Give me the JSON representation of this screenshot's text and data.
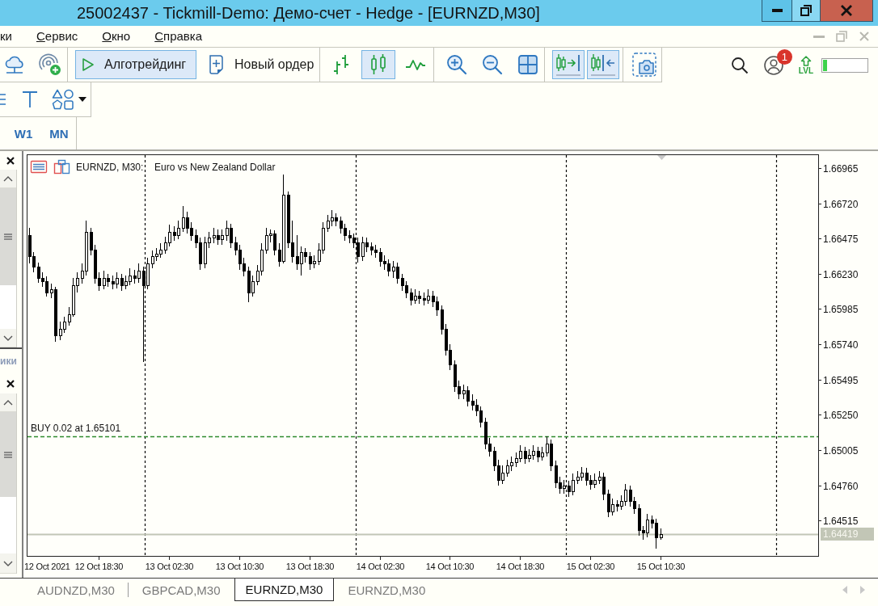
{
  "window": {
    "title": "25002437 - Tickmill-Demo: Демо-счет - Hedge - [EURNZD,M30]"
  },
  "menu": [
    {
      "label": "ки",
      "mnemonic": false
    },
    {
      "label": "Сервис",
      "mnemonic": true
    },
    {
      "label": "Окно",
      "mnemonic": true
    },
    {
      "label": "Справка",
      "mnemonic": true
    }
  ],
  "toolbar": {
    "groups": [
      [
        {
          "selected": false
        },
        {
          "selected": false
        }
      ],
      [
        {
          "label": "Алготрейдинг",
          "selected": true
        },
        {
          "label": "Новый ордер",
          "selected": false
        }
      ],
      [
        {
          "selected": false
        },
        {
          "selected": true
        },
        {
          "selected": false
        }
      ],
      [
        {
          "selected": false
        },
        {
          "selected": false
        },
        {
          "selected": false
        }
      ],
      [
        {
          "selected": true
        },
        {
          "selected": true
        }
      ],
      [
        {
          "selected": false
        }
      ]
    ],
    "account_badge": "1",
    "level_label": "LVL",
    "progress": {
      "level": 0.1
    }
  },
  "timeframes": [
    {
      "label": "W1",
      "selected": false
    },
    {
      "label": "MN",
      "selected": false
    }
  ],
  "dock": {
    "tab_label": "ики"
  },
  "chart": {
    "chart_data": {
      "type": "candlestick",
      "title": "EURNZD, M30:",
      "subtitle": "Euro vs New Zealand Dollar",
      "x": [
        "2021-10-12T10:30",
        "2021-10-12T11:00",
        "2021-10-12T11:30",
        "2021-10-12T12:00",
        "2021-10-12T12:30",
        "2021-10-12T13:00",
        "2021-10-12T13:30",
        "2021-10-12T14:00",
        "2021-10-12T14:30",
        "2021-10-12T15:00",
        "2021-10-12T15:30",
        "2021-10-12T16:00",
        "2021-10-12T16:30",
        "2021-10-12T17:00",
        "2021-10-12T17:30",
        "2021-10-12T18:00",
        "2021-10-12T18:30",
        "2021-10-12T19:00",
        "2021-10-12T19:30",
        "2021-10-12T20:00",
        "2021-10-12T20:30",
        "2021-10-12T21:00",
        "2021-10-12T21:30",
        "2021-10-12T22:00",
        "2021-10-12T22:30",
        "2021-10-12T23:00",
        "2021-10-12T23:30",
        "2021-10-13T00:00",
        "2021-10-13T00:30",
        "2021-10-13T01:00",
        "2021-10-13T01:30",
        "2021-10-13T02:00",
        "2021-10-13T02:30",
        "2021-10-13T03:00",
        "2021-10-13T03:30",
        "2021-10-13T04:00",
        "2021-10-13T04:30",
        "2021-10-13T05:00",
        "2021-10-13T05:30",
        "2021-10-13T06:00",
        "2021-10-13T06:30",
        "2021-10-13T07:00",
        "2021-10-13T07:30",
        "2021-10-13T08:00",
        "2021-10-13T08:30",
        "2021-10-13T09:00",
        "2021-10-13T09:30",
        "2021-10-13T10:00",
        "2021-10-13T10:30",
        "2021-10-13T11:00",
        "2021-10-13T11:30",
        "2021-10-13T12:00",
        "2021-10-13T12:30",
        "2021-10-13T13:00",
        "2021-10-13T13:30",
        "2021-10-13T14:00",
        "2021-10-13T14:30",
        "2021-10-13T15:00",
        "2021-10-13T15:30",
        "2021-10-13T16:00",
        "2021-10-13T16:30",
        "2021-10-13T17:00",
        "2021-10-13T17:30",
        "2021-10-13T18:00",
        "2021-10-13T18:30",
        "2021-10-13T19:00",
        "2021-10-13T19:30",
        "2021-10-13T20:00",
        "2021-10-13T20:30",
        "2021-10-13T21:00",
        "2021-10-13T21:30",
        "2021-10-13T22:00",
        "2021-10-13T22:30",
        "2021-10-13T23:00",
        "2021-10-13T23:30",
        "2021-10-14T00:00",
        "2021-10-14T00:30",
        "2021-10-14T01:00",
        "2021-10-14T01:30",
        "2021-10-14T02:00",
        "2021-10-14T02:30",
        "2021-10-14T03:00",
        "2021-10-14T03:30",
        "2021-10-14T04:00",
        "2021-10-14T04:30",
        "2021-10-14T05:00",
        "2021-10-14T05:30",
        "2021-10-14T06:00",
        "2021-10-14T06:30",
        "2021-10-14T07:00",
        "2021-10-14T07:30",
        "2021-10-14T08:00",
        "2021-10-14T08:30",
        "2021-10-14T09:00",
        "2021-10-14T09:30",
        "2021-10-14T10:00",
        "2021-10-14T10:30",
        "2021-10-14T11:00",
        "2021-10-14T11:30",
        "2021-10-14T12:00",
        "2021-10-14T12:30",
        "2021-10-14T13:00",
        "2021-10-14T13:30",
        "2021-10-14T14:00",
        "2021-10-14T14:30",
        "2021-10-14T15:00",
        "2021-10-14T15:30",
        "2021-10-14T16:00",
        "2021-10-14T16:30",
        "2021-10-14T17:00",
        "2021-10-14T17:30",
        "2021-10-14T18:00",
        "2021-10-14T18:30",
        "2021-10-14T19:00",
        "2021-10-14T19:30",
        "2021-10-14T20:00",
        "2021-10-14T20:30",
        "2021-10-14T21:00",
        "2021-10-14T21:30",
        "2021-10-14T22:00",
        "2021-10-14T22:30",
        "2021-10-14T23:00",
        "2021-10-14T23:30",
        "2021-10-15T00:00",
        "2021-10-15T00:30",
        "2021-10-15T01:00",
        "2021-10-15T01:30",
        "2021-10-15T02:00",
        "2021-10-15T02:30",
        "2021-10-15T03:00",
        "2021-10-15T03:30",
        "2021-10-15T04:00",
        "2021-10-15T04:30",
        "2021-10-15T05:00",
        "2021-10-15T05:30",
        "2021-10-15T06:00",
        "2021-10-15T06:30",
        "2021-10-15T07:00",
        "2021-10-15T07:30",
        "2021-10-15T08:00",
        "2021-10-15T08:30",
        "2021-10-15T09:00",
        "2021-10-15T09:30",
        "2021-10-15T10:00",
        "2021-10-15T10:30"
      ],
      "ohlc": [
        [
          1.665,
          1.6655,
          1.663,
          1.6635
        ],
        [
          1.6635,
          1.6638,
          1.6624,
          1.6628
        ],
        [
          1.6628,
          1.6631,
          1.6617,
          1.662
        ],
        [
          1.662,
          1.6624,
          1.6614,
          1.6618
        ],
        [
          1.6618,
          1.6621,
          1.6607,
          1.661
        ],
        [
          1.661,
          1.6616,
          1.6606,
          1.6612
        ],
        [
          1.6612,
          1.6614,
          1.6576,
          1.658
        ],
        [
          1.658,
          1.659,
          1.6577,
          1.6585
        ],
        [
          1.6585,
          1.6593,
          1.6582,
          1.659
        ],
        [
          1.659,
          1.66,
          1.6587,
          1.6595
        ],
        [
          1.6595,
          1.662,
          1.6593,
          1.6615
        ],
        [
          1.6615,
          1.6624,
          1.661,
          1.662
        ],
        [
          1.662,
          1.663,
          1.6616,
          1.6625
        ],
        [
          1.6625,
          1.666,
          1.6622,
          1.6652
        ],
        [
          1.6652,
          1.6655,
          1.6636,
          1.664
        ],
        [
          1.664,
          1.6643,
          1.6616,
          1.662
        ],
        [
          1.662,
          1.6624,
          1.6611,
          1.6615
        ],
        [
          1.6615,
          1.6625,
          1.6612,
          1.662
        ],
        [
          1.662,
          1.6623,
          1.6614,
          1.6618
        ],
        [
          1.6618,
          1.6622,
          1.6612,
          1.6616
        ],
        [
          1.6616,
          1.6624,
          1.6613,
          1.662
        ],
        [
          1.662,
          1.6623,
          1.6611,
          1.6615
        ],
        [
          1.6615,
          1.6622,
          1.6612,
          1.6618
        ],
        [
          1.6618,
          1.6627,
          1.6615,
          1.6622
        ],
        [
          1.6622,
          1.6626,
          1.6616,
          1.662
        ],
        [
          1.662,
          1.663,
          1.6617,
          1.6625
        ],
        [
          1.6625,
          1.6628,
          1.6562,
          1.6615
        ],
        [
          1.6615,
          1.6634,
          1.6612,
          1.663
        ],
        [
          1.663,
          1.6639,
          1.6627,
          1.6635
        ],
        [
          1.6635,
          1.6641,
          1.6632,
          1.6637
        ],
        [
          1.6637,
          1.6644,
          1.6634,
          1.664
        ],
        [
          1.664,
          1.6649,
          1.6637,
          1.6645
        ],
        [
          1.6645,
          1.6657,
          1.6642,
          1.6652
        ],
        [
          1.6652,
          1.6656,
          1.6646,
          1.665
        ],
        [
          1.665,
          1.666,
          1.6647,
          1.6655
        ],
        [
          1.6655,
          1.667,
          1.6652,
          1.6662
        ],
        [
          1.6662,
          1.6666,
          1.6651,
          1.6655
        ],
        [
          1.6655,
          1.6659,
          1.6646,
          1.665
        ],
        [
          1.665,
          1.6654,
          1.6641,
          1.6645
        ],
        [
          1.6645,
          1.6648,
          1.6626,
          1.663
        ],
        [
          1.663,
          1.6649,
          1.6627,
          1.6645
        ],
        [
          1.6645,
          1.6652,
          1.6641,
          1.6648
        ],
        [
          1.6648,
          1.6655,
          1.6644,
          1.665
        ],
        [
          1.665,
          1.6654,
          1.6643,
          1.6647
        ],
        [
          1.6647,
          1.6654,
          1.6643,
          1.665
        ],
        [
          1.665,
          1.666,
          1.6646,
          1.6655
        ],
        [
          1.6655,
          1.6658,
          1.6641,
          1.6645
        ],
        [
          1.6645,
          1.6649,
          1.6636,
          1.664
        ],
        [
          1.664,
          1.6643,
          1.6626,
          1.663
        ],
        [
          1.663,
          1.6634,
          1.6621,
          1.6625
        ],
        [
          1.6625,
          1.6628,
          1.6603,
          1.661
        ],
        [
          1.661,
          1.6622,
          1.6607,
          1.6618
        ],
        [
          1.6618,
          1.6629,
          1.6615,
          1.6625
        ],
        [
          1.6625,
          1.6644,
          1.6622,
          1.664
        ],
        [
          1.664,
          1.6655,
          1.6637,
          1.665
        ],
        [
          1.665,
          1.6654,
          1.6645,
          1.6651
        ],
        [
          1.6651,
          1.6653,
          1.6636,
          1.664
        ],
        [
          1.664,
          1.6644,
          1.6628,
          1.6632
        ],
        [
          1.6632,
          1.6692,
          1.663,
          1.6678
        ],
        [
          1.6678,
          1.668,
          1.6641,
          1.6645
        ],
        [
          1.6645,
          1.666,
          1.6631,
          1.6635
        ],
        [
          1.6635,
          1.665,
          1.6626,
          1.663
        ],
        [
          1.663,
          1.6642,
          1.6622,
          1.6638
        ],
        [
          1.6638,
          1.6641,
          1.6631,
          1.6635
        ],
        [
          1.6635,
          1.6638,
          1.6626,
          1.663
        ],
        [
          1.663,
          1.6636,
          1.6627,
          1.6632
        ],
        [
          1.6632,
          1.6644,
          1.6629,
          1.664
        ],
        [
          1.664,
          1.6659,
          1.6637,
          1.6655
        ],
        [
          1.6655,
          1.6664,
          1.6652,
          1.666
        ],
        [
          1.666,
          1.6667,
          1.6656,
          1.6662
        ],
        [
          1.6662,
          1.6665,
          1.6656,
          1.666
        ],
        [
          1.666,
          1.6663,
          1.6651,
          1.6655
        ],
        [
          1.6655,
          1.6658,
          1.6646,
          1.665
        ],
        [
          1.665,
          1.6653,
          1.6644,
          1.6648
        ],
        [
          1.6648,
          1.6651,
          1.6641,
          1.6645
        ],
        [
          1.6645,
          1.6648,
          1.6631,
          1.6635
        ],
        [
          1.6635,
          1.6649,
          1.6632,
          1.6645
        ],
        [
          1.6645,
          1.6648,
          1.6638,
          1.6642
        ],
        [
          1.6642,
          1.6645,
          1.6636,
          1.664
        ],
        [
          1.664,
          1.6643,
          1.6634,
          1.6638
        ],
        [
          1.6638,
          1.6641,
          1.6628,
          1.6632
        ],
        [
          1.6632,
          1.6636,
          1.6626,
          1.663
        ],
        [
          1.663,
          1.6633,
          1.6621,
          1.6625
        ],
        [
          1.6625,
          1.6632,
          1.662,
          1.6628
        ],
        [
          1.6628,
          1.6631,
          1.6616,
          1.662
        ],
        [
          1.662,
          1.6623,
          1.6611,
          1.6615
        ],
        [
          1.6615,
          1.6618,
          1.6606,
          1.661
        ],
        [
          1.661,
          1.6613,
          1.6601,
          1.6605
        ],
        [
          1.6605,
          1.6612,
          1.6602,
          1.6608
        ],
        [
          1.6608,
          1.6611,
          1.6602,
          1.6606
        ],
        [
          1.6606,
          1.661,
          1.6601,
          1.6605
        ],
        [
          1.6605,
          1.6612,
          1.6602,
          1.6608
        ],
        [
          1.6608,
          1.6611,
          1.66,
          1.6604
        ],
        [
          1.6604,
          1.6607,
          1.6594,
          1.6598
        ],
        [
          1.6598,
          1.6601,
          1.6581,
          1.6585
        ],
        [
          1.6585,
          1.6588,
          1.6566,
          1.657
        ],
        [
          1.657,
          1.6574,
          1.6556,
          1.656
        ],
        [
          1.656,
          1.6563,
          1.6541,
          1.6545
        ],
        [
          1.6545,
          1.6549,
          1.6536,
          1.654
        ],
        [
          1.654,
          1.6546,
          1.6536,
          1.6542
        ],
        [
          1.6542,
          1.6545,
          1.6531,
          1.6535
        ],
        [
          1.6535,
          1.6539,
          1.6528,
          1.6532
        ],
        [
          1.6532,
          1.6536,
          1.6524,
          1.6528
        ],
        [
          1.6528,
          1.6531,
          1.6516,
          1.652
        ],
        [
          1.652,
          1.6523,
          1.6501,
          1.6505
        ],
        [
          1.6505,
          1.6509,
          1.6496,
          1.65
        ],
        [
          1.65,
          1.6503,
          1.6486,
          1.649
        ],
        [
          1.649,
          1.6494,
          1.6476,
          1.648
        ],
        [
          1.648,
          1.649,
          1.6477,
          1.6485
        ],
        [
          1.6485,
          1.6494,
          1.6482,
          1.649
        ],
        [
          1.649,
          1.6496,
          1.6486,
          1.6492
        ],
        [
          1.6492,
          1.6499,
          1.6489,
          1.6495
        ],
        [
          1.6495,
          1.6504,
          1.6492,
          1.65
        ],
        [
          1.65,
          1.6503,
          1.6491,
          1.6495
        ],
        [
          1.6495,
          1.6501,
          1.6492,
          1.6497
        ],
        [
          1.6497,
          1.6504,
          1.6494,
          1.65
        ],
        [
          1.65,
          1.6503,
          1.6492,
          1.6496
        ],
        [
          1.6496,
          1.6503,
          1.6493,
          1.6499
        ],
        [
          1.6499,
          1.651,
          1.6496,
          1.6505
        ],
        [
          1.6505,
          1.6508,
          1.6486,
          1.649
        ],
        [
          1.649,
          1.6493,
          1.6474,
          1.6478
        ],
        [
          1.6478,
          1.6482,
          1.647,
          1.6474
        ],
        [
          1.6474,
          1.648,
          1.647,
          1.6476
        ],
        [
          1.6476,
          1.6479,
          1.6468,
          1.6472
        ],
        [
          1.6472,
          1.6484,
          1.6469,
          1.648
        ],
        [
          1.648,
          1.6486,
          1.6477,
          1.6482
        ],
        [
          1.6482,
          1.6489,
          1.6479,
          1.6485
        ],
        [
          1.6485,
          1.6488,
          1.6476,
          1.648
        ],
        [
          1.648,
          1.6483,
          1.6473,
          1.6477
        ],
        [
          1.6477,
          1.6484,
          1.6474,
          1.648
        ],
        [
          1.648,
          1.6486,
          1.6477,
          1.6482
        ],
        [
          1.6482,
          1.6485,
          1.6466,
          1.647
        ],
        [
          1.647,
          1.6473,
          1.6454,
          1.6458
        ],
        [
          1.6458,
          1.6467,
          1.6455,
          1.6463
        ],
        [
          1.6463,
          1.6466,
          1.6458,
          1.6462
        ],
        [
          1.6462,
          1.6469,
          1.6459,
          1.6465
        ],
        [
          1.6465,
          1.6477,
          1.6462,
          1.6473
        ],
        [
          1.6473,
          1.6476,
          1.6461,
          1.6465
        ],
        [
          1.6465,
          1.6468,
          1.6456,
          1.646
        ],
        [
          1.646,
          1.6463,
          1.6441,
          1.6445
        ],
        [
          1.6445,
          1.6448,
          1.6438,
          1.6443
        ],
        [
          1.6443,
          1.6456,
          1.644,
          1.6452
        ],
        [
          1.6452,
          1.6455,
          1.6446,
          1.645
        ],
        [
          1.645,
          1.6453,
          1.6432,
          1.644
        ],
        [
          1.644,
          1.6446,
          1.6438,
          1.6442
        ]
      ],
      "xlim": [
        "2021-10-12T10:15",
        "2021-10-16T04:30"
      ],
      "ylim": [
        1.6427,
        1.6706
      ],
      "xticks": [
        {
          "value": "2021-10-12T18:30",
          "label": "12 Oct 18:30"
        },
        {
          "value": "2021-10-13T02:30",
          "label": "13 Oct 02:30"
        },
        {
          "value": "2021-10-13T10:30",
          "label": "13 Oct 10:30"
        },
        {
          "value": "2021-10-13T18:30",
          "label": "13 Oct 18:30"
        },
        {
          "value": "2021-10-14T02:30",
          "label": "14 Oct 02:30"
        },
        {
          "value": "2021-10-14T10:30",
          "label": "14 Oct 10:30"
        },
        {
          "value": "2021-10-14T18:30",
          "label": "14 Oct 18:30"
        },
        {
          "value": "2021-10-15T02:30",
          "label": "15 Oct 02:30"
        },
        {
          "value": "2021-10-15T10:30",
          "label": "15 Oct 10:30"
        }
      ],
      "yticks": [
        {
          "value": 1.66965,
          "label": "1.66965"
        },
        {
          "value": 1.6672,
          "label": "1.66720"
        },
        {
          "value": 1.66475,
          "label": "1.66475"
        },
        {
          "value": 1.6623,
          "label": "1.66230"
        },
        {
          "value": 1.65985,
          "label": "1.65985"
        },
        {
          "value": 1.6574,
          "label": "1.65740"
        },
        {
          "value": 1.65495,
          "label": "1.65495"
        },
        {
          "value": 1.6525,
          "label": "1.65250"
        },
        {
          "value": 1.65005,
          "label": "1.65005"
        },
        {
          "value": 1.6476,
          "label": "1.64760"
        },
        {
          "value": 1.64515,
          "label": "1.64515"
        }
      ],
      "ref_lines": [
        {
          "axis": "x",
          "value": "2021-10-12T23:45",
          "color": "#000000",
          "line_style": "dotted"
        },
        {
          "axis": "x",
          "value": "2021-10-13T23:45",
          "color": "#000000",
          "line_style": "dotted"
        },
        {
          "axis": "x",
          "value": "2021-10-14T23:45",
          "color": "#000000",
          "line_style": "dotted"
        },
        {
          "axis": "x",
          "value": "2021-10-15T23:45",
          "color": "#000000",
          "line_style": "dotted"
        },
        {
          "axis": "y",
          "value": 1.65101,
          "label": "BUY 0.02 at 1.65101",
          "color": "#2e8b2e",
          "line_style": "dashed"
        },
        {
          "axis": "y",
          "value": 1.64419,
          "label": "1.64419",
          "color": "#c2c6b6",
          "line_style": "solid"
        }
      ],
      "annotations": [
        "12 Oct 2021"
      ]
    }
  },
  "tabs": [
    {
      "label": "AUDNZD,M30",
      "selected": false
    },
    {
      "label": "GBPCAD,M30",
      "selected": false
    },
    {
      "label": "EURNZD,M30",
      "selected": true
    },
    {
      "label": "EURNZD,M30",
      "selected": false
    }
  ]
}
